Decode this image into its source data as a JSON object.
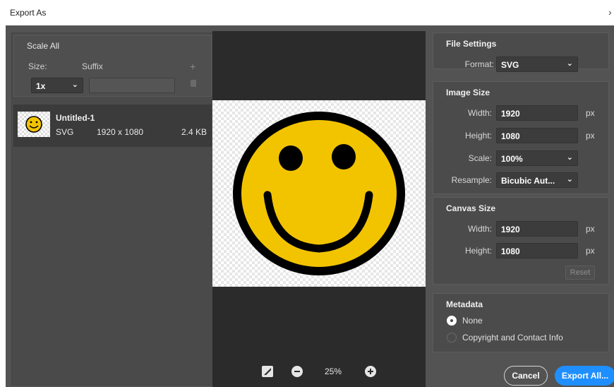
{
  "window": {
    "title": "Export As",
    "close_glyph": "›"
  },
  "scale_all": {
    "title": "Scale All",
    "size_label": "Size:",
    "suffix_label": "Suffix",
    "add_icon": "plus-icon",
    "delete_icon": "trash-icon",
    "scale_value": "1x",
    "suffix_value": ""
  },
  "asset": {
    "name": "Untitled-1",
    "type": "SVG",
    "dimensions": "1920 x 1080",
    "file_size": "2.4 KB"
  },
  "preview": {
    "zoom_level": "25%",
    "image": {
      "face_color": "#f2c400",
      "outline_color": "#000000"
    }
  },
  "file_settings": {
    "title": "File Settings",
    "format_label": "Format:",
    "format_value": "SVG"
  },
  "image_size": {
    "title": "Image Size",
    "width_label": "Width:",
    "width_value": "1920",
    "height_label": "Height:",
    "height_value": "1080",
    "scale_label": "Scale:",
    "scale_value": "100%",
    "resample_label": "Resample:",
    "resample_value": "Bicubic Aut...",
    "unit": "px"
  },
  "canvas_size": {
    "title": "Canvas Size",
    "width_label": "Width:",
    "width_value": "1920",
    "height_label": "Height:",
    "height_value": "1080",
    "unit": "px",
    "reset_label": "Reset"
  },
  "metadata": {
    "title": "Metadata",
    "options": [
      {
        "label": "None",
        "selected": true
      },
      {
        "label": "Copyright and Contact Info",
        "selected": false
      }
    ]
  },
  "buttons": {
    "cancel": "Cancel",
    "export_all": "Export All..."
  },
  "colors": {
    "accent": "#1f8fff",
    "panel": "#535353",
    "preview_bg": "#2b2b2b"
  }
}
